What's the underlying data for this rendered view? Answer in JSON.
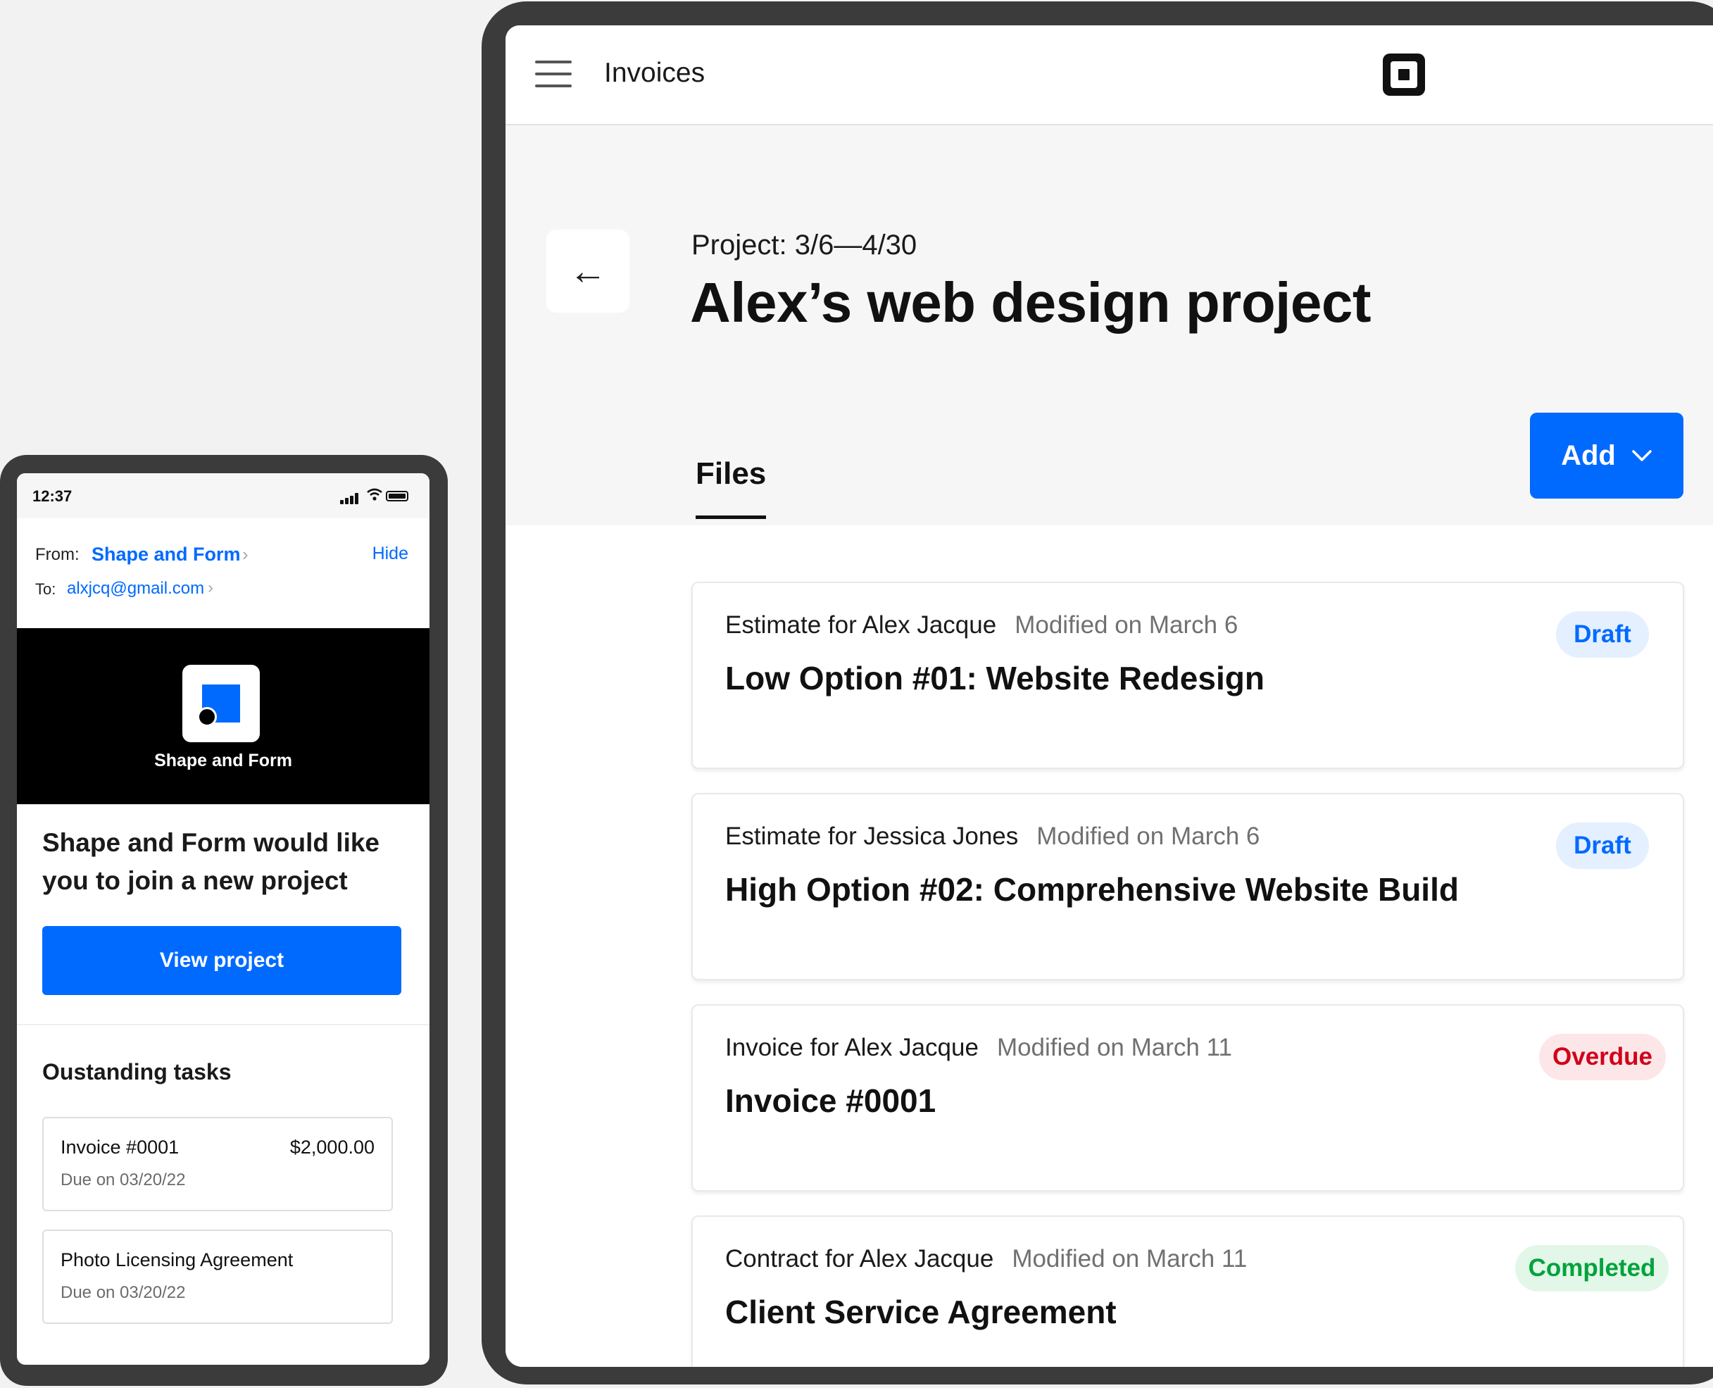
{
  "tablet": {
    "app_title": "Invoices",
    "project_dates": "Project: 3/6—4/30",
    "project_title": "Alex’s web design project",
    "tab_label": "Files",
    "add_button_label": "Add",
    "files": [
      {
        "meta": "Estimate for Alex Jacque",
        "modified": "Modified on March 6",
        "title": "Low Option #01: Website Redesign",
        "status": "Draft",
        "status_color": "#006aff",
        "status_bg": "#e4f0ff"
      },
      {
        "meta": "Estimate for Jessica Jones",
        "modified": "Modified on March 6",
        "title": "High Option #02: Comprehensive Website Build",
        "status": "Draft",
        "status_color": "#006aff",
        "status_bg": "#e4f0ff"
      },
      {
        "meta": "Invoice for Alex Jacque",
        "modified": "Modified on March 11",
        "title": "Invoice #0001",
        "status": "Overdue",
        "status_color": "#d0021b",
        "status_bg": "#fde6e8"
      },
      {
        "meta": "Contract for Alex Jacque",
        "modified": "Modified on March 11",
        "title": "Client Service Agreement",
        "status": "Completed",
        "status_color": "#00a33c",
        "status_bg": "#e2f7e8"
      }
    ]
  },
  "phone": {
    "status_time": "12:37",
    "from_label": "From:",
    "from_value": "Shape and Form",
    "hide_label": "Hide",
    "to_label": "To:",
    "to_value": "alxjcq@gmail.com",
    "brand_name": "Shape and Form",
    "invite_text": "Shape and Form would like you to join a new project",
    "view_button_label": "View project",
    "tasks_heading": "Oustanding tasks",
    "tasks": [
      {
        "name": "Invoice #0001",
        "amount": "$2,000.00",
        "due": "Due on 03/20/22"
      },
      {
        "name": "Photo Licensing Agreement",
        "amount": "",
        "due": "Due on 03/20/22"
      }
    ]
  },
  "colors": {
    "accent": "#006aff",
    "device_frame": "#3b3b3b",
    "page_background": "#f2f2f2"
  },
  "icons": [
    "menu-icon",
    "square-logo-icon",
    "back-arrow-icon",
    "chevron-down-icon",
    "signal-icon",
    "wifi-icon",
    "battery-icon",
    "chevron-right-icon",
    "shape-and-form-logo"
  ]
}
